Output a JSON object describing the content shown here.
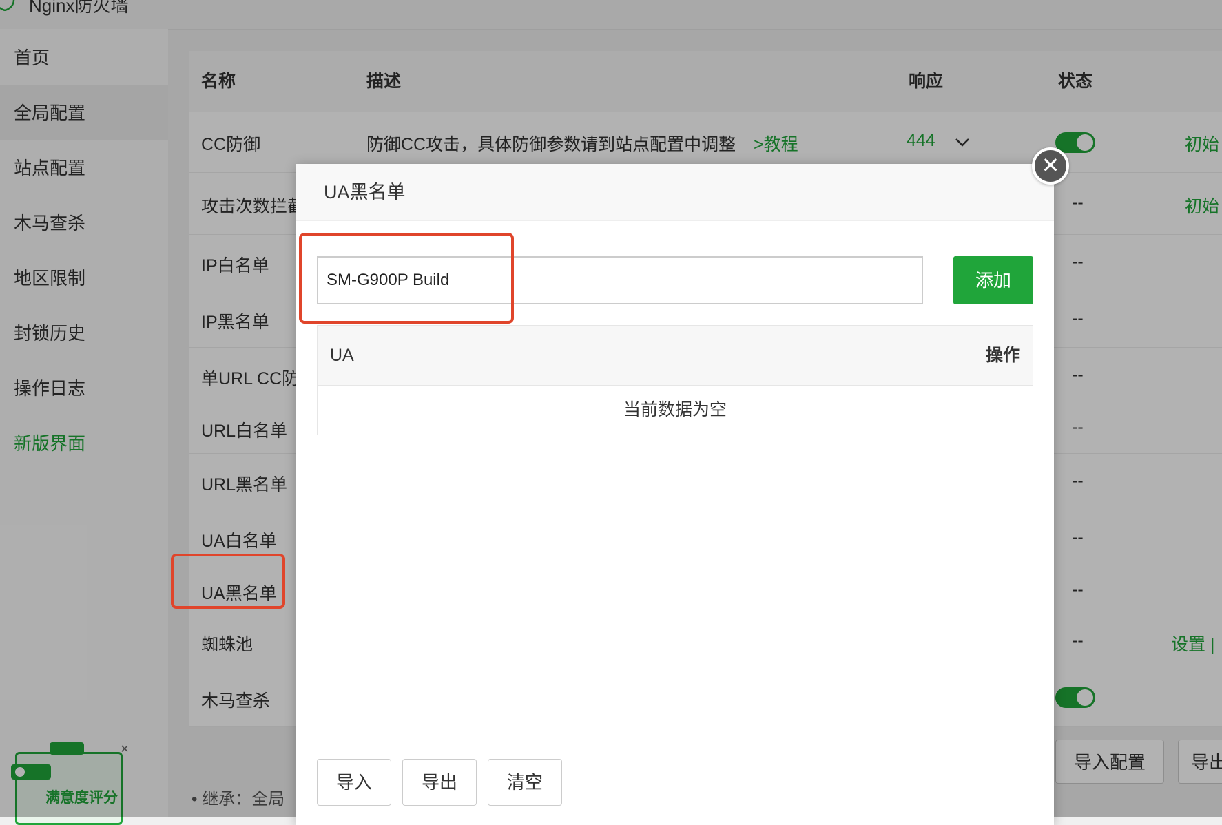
{
  "app": {
    "title": "Nginx防火墙"
  },
  "sidebar": {
    "items": [
      {
        "label": "首页"
      },
      {
        "label": "全局配置"
      },
      {
        "label": "站点配置"
      },
      {
        "label": "木马查杀"
      },
      {
        "label": "地区限制"
      },
      {
        "label": "封锁历史"
      },
      {
        "label": "操作日志"
      },
      {
        "label": "新版界面"
      }
    ],
    "active_item": "全局配置",
    "survey_label": "满意度评分"
  },
  "table": {
    "headers": {
      "name": "名称",
      "desc": "描述",
      "response": "响应",
      "status": "状态"
    },
    "rows": [
      {
        "name": "CC防御",
        "desc": "防御CC攻击，具体防御参数请到站点配置中调整",
        "desc_link": ">教程",
        "response": "444",
        "status": "on",
        "action": "初始"
      },
      {
        "name": "攻击次数拦截",
        "status": "--",
        "action": "初始"
      },
      {
        "name": "IP白名单",
        "status": "--"
      },
      {
        "name": "IP黑名单",
        "status": "--"
      },
      {
        "name": "单URL CC防御",
        "status": "--"
      },
      {
        "name": "URL白名单",
        "status": "--"
      },
      {
        "name": "URL黑名单",
        "status": "--"
      },
      {
        "name": "UA白名单",
        "status": "--"
      },
      {
        "name": "UA黑名单",
        "status": "--"
      },
      {
        "name": "蜘蛛池",
        "status": "--",
        "action": "设置 |"
      },
      {
        "name": "木马查杀",
        "status": "on"
      }
    ],
    "import_config": "导入配置",
    "export_config": "导出",
    "inherit_note": "继承：全局"
  },
  "modal": {
    "title": "UA黑名单",
    "input_value": "SM-G900P Build",
    "add_label": "添加",
    "col_ua": "UA",
    "col_action": "操作",
    "empty_text": "当前数据为空",
    "import_label": "导入",
    "export_label": "导出",
    "clear_label": "清空",
    "close_symbol": "✕"
  },
  "colors": {
    "accent": "#20a53a",
    "annotation": "#e0452b"
  }
}
